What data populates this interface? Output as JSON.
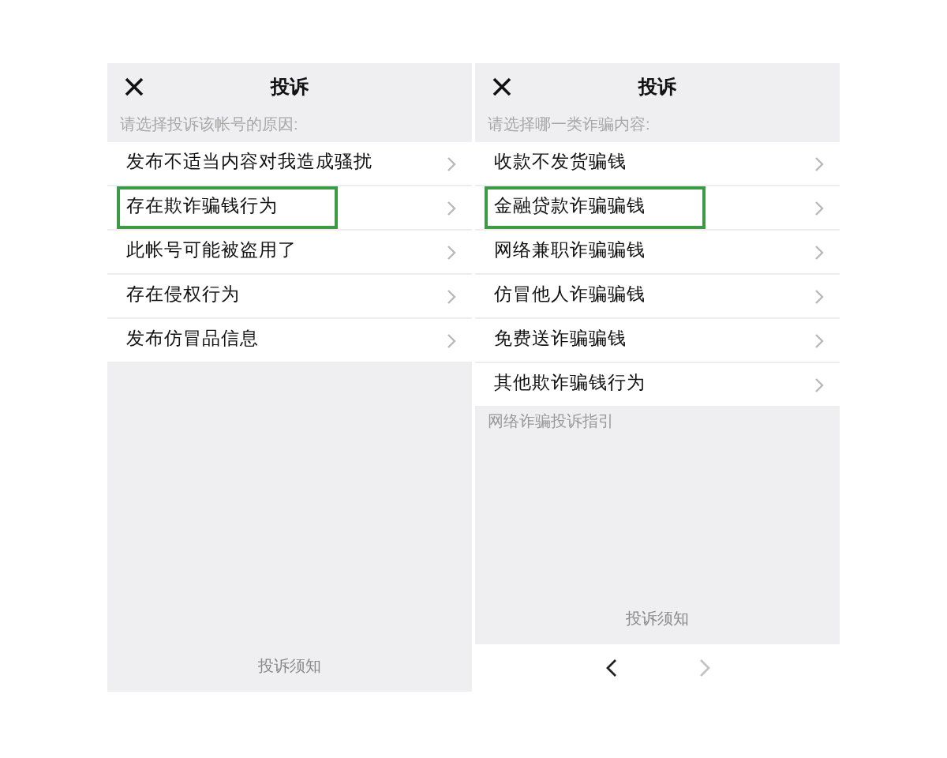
{
  "panels": [
    {
      "title": "投诉",
      "prompt": "请选择投诉该帐号的原因:",
      "items": [
        {
          "label": "发布不适当内容对我造成骚扰",
          "highlighted": false
        },
        {
          "label": "存在欺诈骗钱行为",
          "highlighted": true
        },
        {
          "label": "此帐号可能被盗用了",
          "highlighted": false
        },
        {
          "label": "存在侵权行为",
          "highlighted": false
        },
        {
          "label": "发布仿冒品信息",
          "highlighted": false
        }
      ],
      "footer_link": "投诉须知"
    },
    {
      "title": "投诉",
      "prompt": "请选择哪一类诈骗内容:",
      "items": [
        {
          "label": "收款不发货骗钱",
          "highlighted": false
        },
        {
          "label": "金融贷款诈骗骗钱",
          "highlighted": true
        },
        {
          "label": "网络兼职诈骗骗钱",
          "highlighted": false
        },
        {
          "label": "仿冒他人诈骗骗钱",
          "highlighted": false
        },
        {
          "label": "免费送诈骗骗钱",
          "highlighted": false
        },
        {
          "label": "其他欺诈骗钱行为",
          "highlighted": false
        }
      ],
      "guide_link": "网络诈骗投诉指引",
      "footer_link": "投诉须知",
      "nav": {
        "back_disabled": false,
        "forward_disabled": true
      }
    }
  ]
}
